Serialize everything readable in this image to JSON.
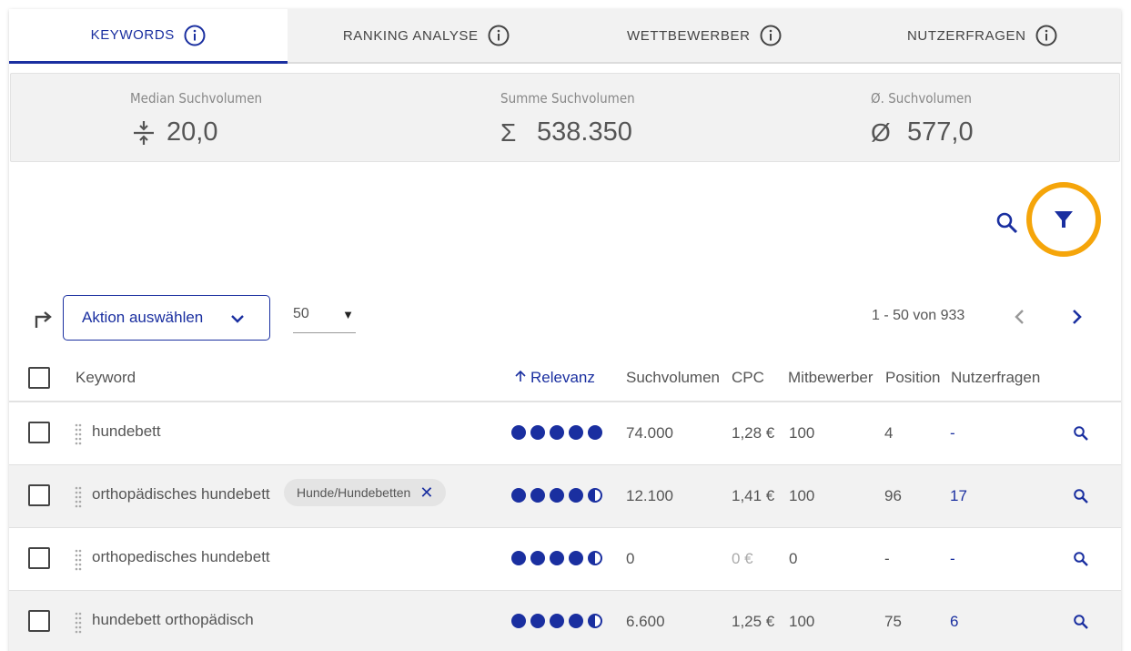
{
  "tabs": [
    {
      "label": "KEYWORDS",
      "active": true
    },
    {
      "label": "RANKING ANALYSE",
      "active": false
    },
    {
      "label": "WETTBEWERBER",
      "active": false
    },
    {
      "label": "NUTZERFRAGEN",
      "active": false
    }
  ],
  "stats": {
    "median": {
      "label": "Median Suchvolumen",
      "symbol": "median-icon",
      "value": "20,0"
    },
    "sum": {
      "label": "Summe Suchvolumen",
      "symbol": "Σ",
      "value": "538.350"
    },
    "avg": {
      "label": "Ø. Suchvolumen",
      "symbol": "Ø",
      "value": "577,0"
    }
  },
  "toolbar": {
    "action_label": "Aktion auswählen",
    "per_page": "50",
    "pagination": "1 - 50 von 933"
  },
  "table": {
    "headers": {
      "keyword": "Keyword",
      "relevance": "Relevanz",
      "volume": "Suchvolumen",
      "cpc": "CPC",
      "competitors": "Mitbewerber",
      "position": "Position",
      "questions": "Nutzerfragen"
    },
    "rows": [
      {
        "keyword": "hundebett",
        "tag": "",
        "relevance_full": 5,
        "relevance_half": 0,
        "volume": "74.000",
        "cpc": "1,28 €",
        "competitors": "100",
        "position": "4",
        "questions": "-"
      },
      {
        "keyword": "orthopädisches hundebett",
        "tag": "Hunde/Hundebetten",
        "relevance_full": 4,
        "relevance_half": 1,
        "volume": "12.100",
        "cpc": "1,41 €",
        "competitors": "100",
        "position": "96",
        "questions": "17"
      },
      {
        "keyword": "orthopedisches hundebett",
        "tag": "",
        "relevance_full": 4,
        "relevance_half": 1,
        "volume": "0",
        "cpc": "0 €",
        "competitors": "0",
        "position": "-",
        "questions": "-"
      },
      {
        "keyword": "hundebett orthopädisch",
        "tag": "",
        "relevance_full": 4,
        "relevance_half": 1,
        "volume": "6.600",
        "cpc": "1,25 €",
        "competitors": "100",
        "position": "75",
        "questions": "6"
      }
    ]
  },
  "colors": {
    "accent": "#1a2fa0",
    "highlight": "#f5a50a"
  }
}
